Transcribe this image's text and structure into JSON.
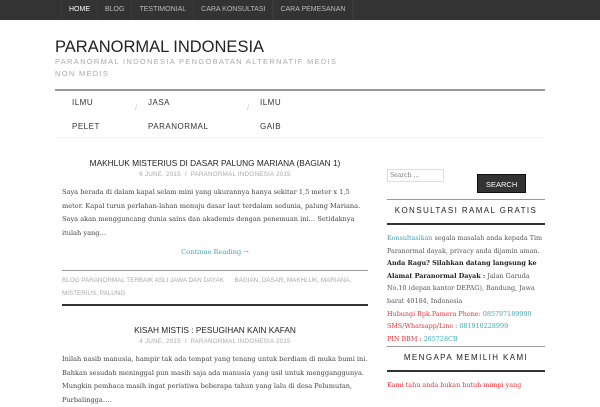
{
  "topnav": [
    "HOME",
    "BLOG",
    "TESTIMONIAL",
    "CARA KONSULTASI",
    "CARA PEMESANAN"
  ],
  "site": {
    "title": "PARANORMAL INDONESIA",
    "tagline": "PARANORMAL INDONESIA PENGOBATAN ALTERNATIF MEDIS NON MEDIS"
  },
  "menu": [
    {
      "l1": "ILMU",
      "l2": "PELET"
    },
    {
      "l1": "JASA",
      "l2": "PARANORMAL"
    },
    {
      "l1": "ILMU",
      "l2": "GAIB"
    }
  ],
  "posts": [
    {
      "title": "MAKHLUK MISTERIUS DI DASAR PALUNG MARIANA (BAGIAN 1)",
      "date": "6 JUNE, 2015",
      "author": "PARANORMAL INDONESIA 2015",
      "excerpt": " Saya berada di dalam kapal selam mini yang ukurannya hanya sekitar 1,5 meter x 1,5 meter. Kapal turun perlahan-lahan menuju dasar laut terdalam sedunia, palung Mariana. Saya akan mengguncang dunia sains dan akademis dengan penemuan ini… Setidaknya itulah yang…",
      "more": "Continue Reading →",
      "category": "BLOG PARANORMAL TERBAIK ASLI JAWA DAN DAYAK",
      "tags": "BAGIAN, DASAR, MAKHLUK, MARIANA, MISTERIUS, PALUNG"
    },
    {
      "title": "KISAH MISTIS : PESUGIHAN KAIN KAFAN",
      "date": "4 JUNE, 2015",
      "author": "PARANORMAL INDONESIA 2015",
      "excerpt": "Inilah nasib manusia, hampir tak ada tempat yang tenang untuk berdiam di  muka bumi ini. Bahkan sesudah meninggal pun masih saja ada manusia yang  usil untuk mengganggunya. Mungkin pembaca masih ingat peristiwa  beberapa tahun yang lalu di desa Pelumutan, Purbalingga…."
    }
  ],
  "sidebar": {
    "search_placeholder": "Search …",
    "search_button": "SEARCH",
    "w1_title": "KONSULTASI RAMAL GRATIS",
    "w1_link": "Konsultasikan",
    "w1_text": " segala masalah anda kepada Tim Paranormal dayak, privacy anda dijamin aman.",
    "w1_bold": "Anda Ragu? Silahkan datang langsung ke Alamat Paranormal Dayak :",
    "w1_addr": " Jalan Garuda No.10 (depan kantor DEPAG), Bandung, Jawa barat 40184, Indonesia",
    "phone_label": "Hubungi Bpk.Pamera Phone: ",
    "phone": "085797189999",
    "sms_label": "SMS/Whatsapp/Line : ",
    "sms": "081910228999",
    "pin_label": "PIN BBM : ",
    "pin": "265728CB",
    "w2_title": "MENGAPA MEMILIH KAMI",
    "w2_text": "Kami tahu anda bukan butuh mimpi yang"
  }
}
